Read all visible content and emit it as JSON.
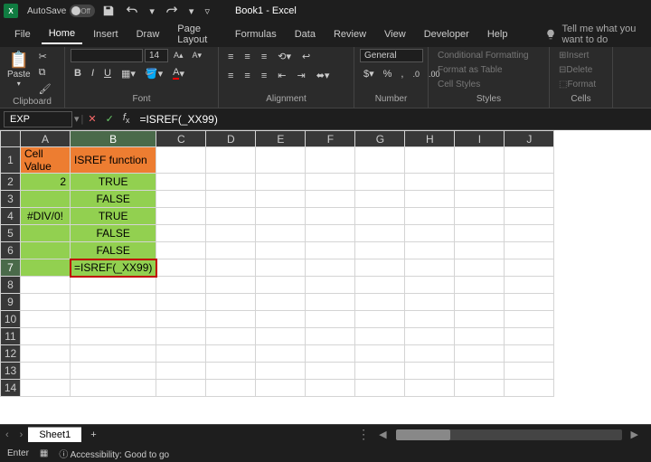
{
  "titlebar": {
    "app": "X",
    "autosave_label": "AutoSave",
    "autosave_state": "Off",
    "title": "Book1 - Excel"
  },
  "menu": {
    "tabs": [
      "File",
      "Home",
      "Insert",
      "Draw",
      "Page Layout",
      "Formulas",
      "Data",
      "Review",
      "View",
      "Developer",
      "Help"
    ],
    "active": "Home",
    "tell_me": "Tell me what you want to do"
  },
  "ribbon": {
    "clipboard": {
      "paste": "Paste",
      "label": "Clipboard"
    },
    "font": {
      "size": "14",
      "bold": "B",
      "italic": "I",
      "underline": "U",
      "label": "Font"
    },
    "alignment": {
      "label": "Alignment"
    },
    "number": {
      "format": "General",
      "label": "Number"
    },
    "styles": {
      "cond": "Conditional Formatting",
      "table": "Format as Table",
      "cell": "Cell Styles",
      "label": "Styles"
    },
    "cells": {
      "insert": "Insert",
      "delete": "Delete",
      "format": "Format",
      "label": "Cells"
    }
  },
  "formula_bar": {
    "name_box": "EXP",
    "formula": "=ISREF(_XX99)"
  },
  "columns": [
    "A",
    "B",
    "C",
    "D",
    "E",
    "F",
    "G",
    "H",
    "I",
    "J"
  ],
  "rows": [
    "1",
    "2",
    "3",
    "4",
    "5",
    "6",
    "7",
    "8",
    "9",
    "10",
    "11",
    "12",
    "13",
    "14"
  ],
  "cells": {
    "A1": "Cell Value",
    "B1": "ISREF function",
    "A2": "2",
    "B2": "TRUE",
    "B3": "FALSE",
    "A4": "#DIV/0!",
    "B4": "TRUE",
    "B5": "FALSE",
    "B6": "FALSE",
    "B7": "=ISREF(_XX99)"
  },
  "sheet_tabs": {
    "sheet1": "Sheet1"
  },
  "status": {
    "mode": "Enter",
    "accessibility": "Accessibility: Good to go"
  }
}
